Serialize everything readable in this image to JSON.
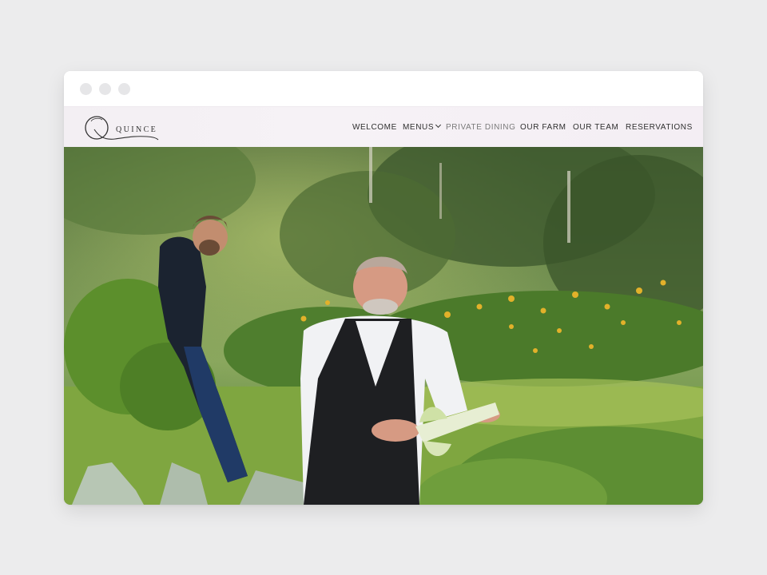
{
  "brand": {
    "name": "Quince"
  },
  "nav": {
    "items": [
      {
        "label": "WELCOME"
      },
      {
        "label": "MENUS"
      },
      {
        "label": "PRIVATE DINING"
      },
      {
        "label": "OUR FARM"
      },
      {
        "label": "OUR TEAM"
      },
      {
        "label": "RESERVATIONS"
      }
    ],
    "active": "PRIVATE DINING"
  },
  "hero": {
    "image_alt": "Two chefs harvesting fennel in a farm field with sunflowers and trees"
  },
  "colors": {
    "page_background": "#ececed",
    "header_background": "#f4f0f4",
    "nav_text": "#2f2f2f",
    "nav_active_text": "#7a7a7a"
  }
}
